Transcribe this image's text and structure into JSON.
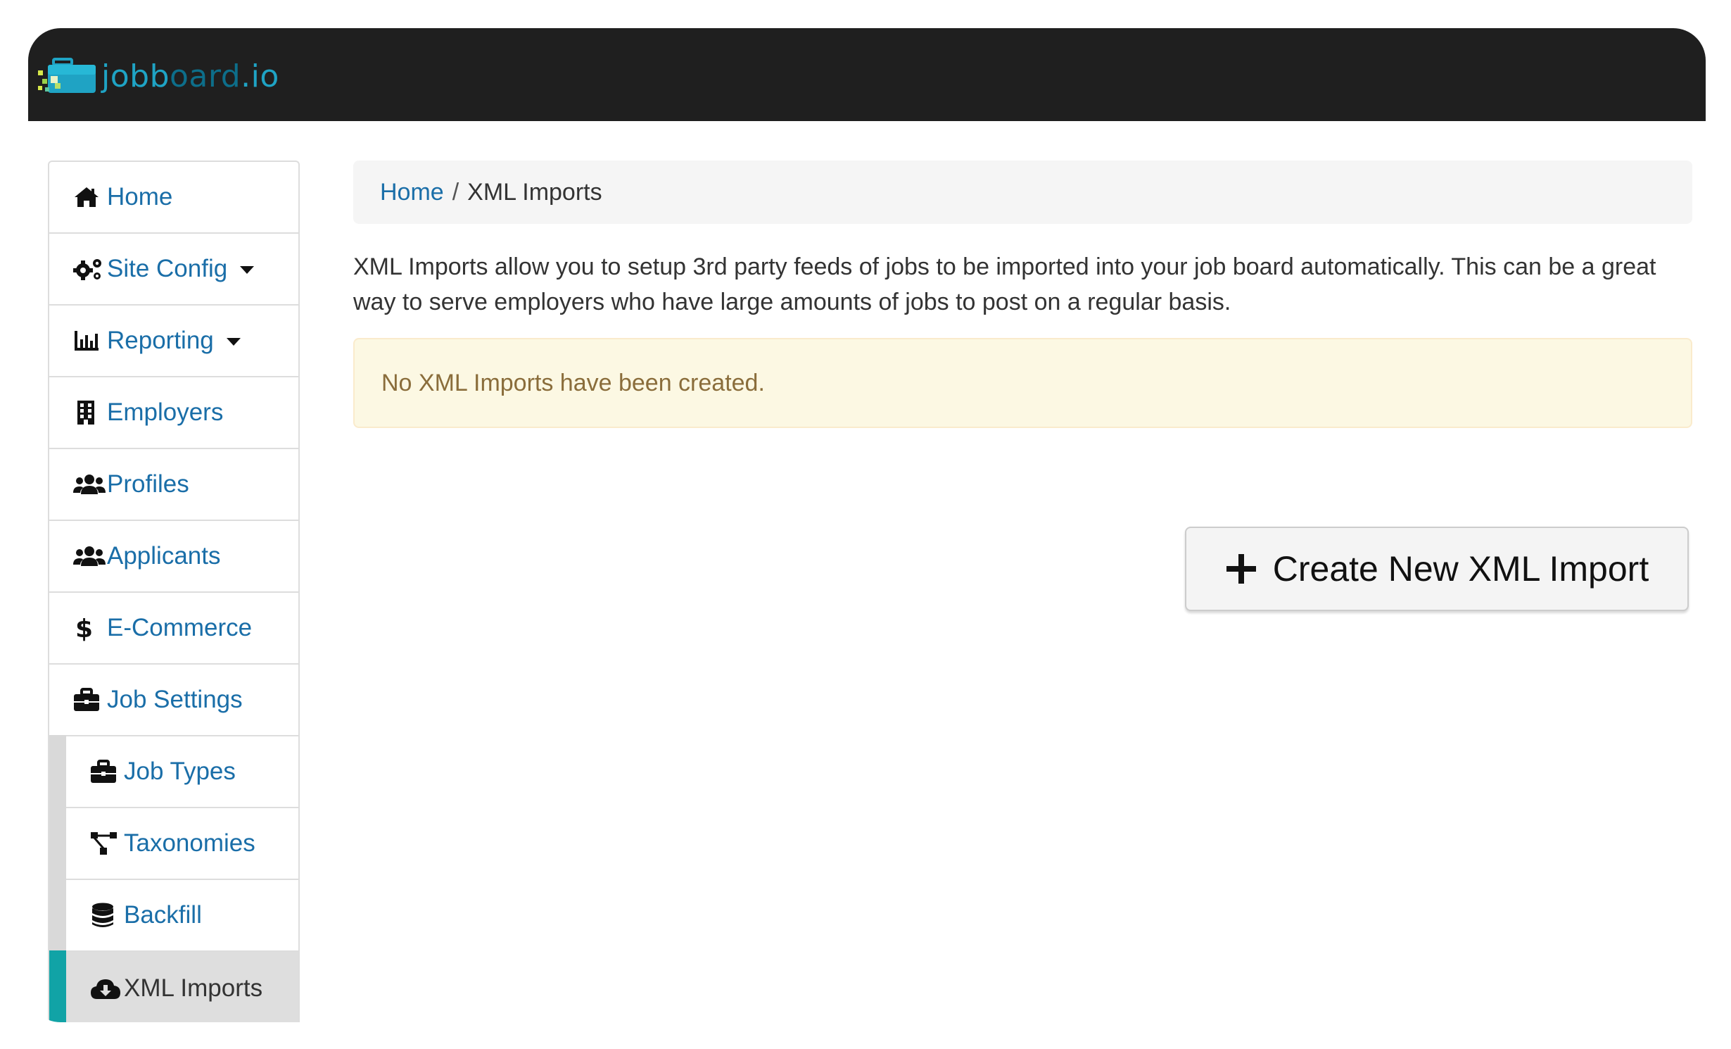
{
  "header": {
    "logo_text_part1": "jobb",
    "logo_text_part2": "oard",
    "logo_text_part3": ".io"
  },
  "sidebar": {
    "items": [
      {
        "label": "Home",
        "icon": "home-icon"
      },
      {
        "label": "Site Config",
        "icon": "cogs-icon",
        "has_dropdown": true
      },
      {
        "label": "Reporting",
        "icon": "bar-chart-icon",
        "has_dropdown": true
      },
      {
        "label": "Employers",
        "icon": "building-icon"
      },
      {
        "label": "Profiles",
        "icon": "users-icon"
      },
      {
        "label": "Applicants",
        "icon": "users-icon"
      },
      {
        "label": "E-Commerce",
        "icon": "dollar-icon"
      },
      {
        "label": "Job Settings",
        "icon": "briefcase-icon"
      }
    ],
    "subitems": [
      {
        "label": "Job Types",
        "icon": "briefcase-icon"
      },
      {
        "label": "Taxonomies",
        "icon": "sitemap-icon"
      },
      {
        "label": "Backfill",
        "icon": "database-icon"
      },
      {
        "label": "XML Imports",
        "icon": "cloud-download-icon",
        "active": true
      }
    ]
  },
  "breadcrumb": {
    "home": "Home",
    "separator": "/",
    "current": "XML Imports"
  },
  "main": {
    "description": "XML Imports allow you to setup 3rd party feeds of jobs to be imported into your job board automatically. This can be a great way to serve employers who have large amounts of jobs to post on a regular basis.",
    "alert_text": "No XML Imports have been created.",
    "create_button_label": "Create New XML Import"
  },
  "colors": {
    "topbar": "#1f1f1f",
    "link": "#1a6ea8",
    "active_accent": "#11a3a6",
    "alert_bg": "#fcf8e3",
    "alert_text": "#8a6d3b"
  }
}
